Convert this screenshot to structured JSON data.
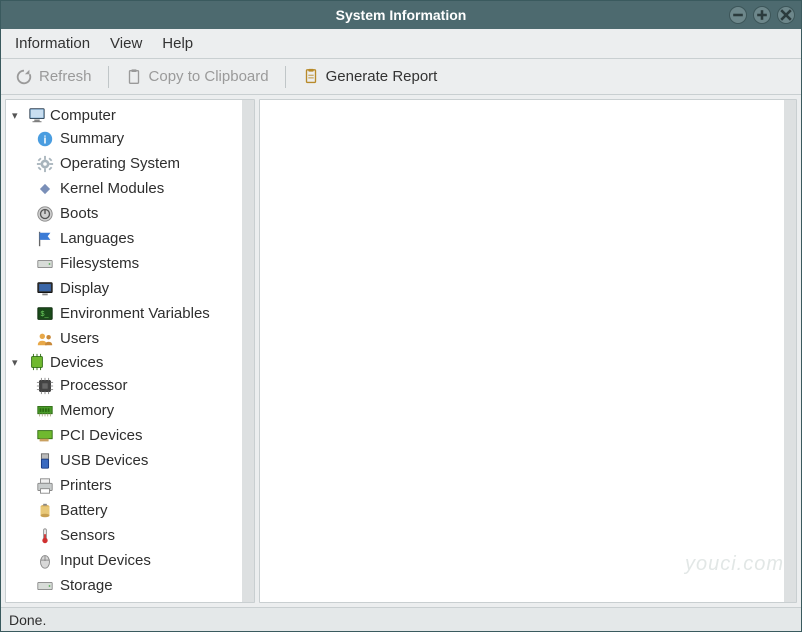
{
  "window": {
    "title": "System Information"
  },
  "menubar": {
    "items": [
      "Information",
      "View",
      "Help"
    ]
  },
  "toolbar": {
    "refresh": "Refresh",
    "copy": "Copy to Clipboard",
    "report": "Generate Report"
  },
  "tree": {
    "groups": [
      {
        "label": "Computer",
        "icon": "computer-icon",
        "items": [
          {
            "label": "Summary",
            "icon": "info-icon"
          },
          {
            "label": "Operating System",
            "icon": "gear-icon"
          },
          {
            "label": "Kernel Modules",
            "icon": "diamond-icon"
          },
          {
            "label": "Boots",
            "icon": "power-icon"
          },
          {
            "label": "Languages",
            "icon": "flag-icon"
          },
          {
            "label": "Filesystems",
            "icon": "drive-icon"
          },
          {
            "label": "Display",
            "icon": "monitor-icon"
          },
          {
            "label": "Environment Variables",
            "icon": "terminal-icon"
          },
          {
            "label": "Users",
            "icon": "users-icon"
          }
        ]
      },
      {
        "label": "Devices",
        "icon": "chip-green-icon",
        "items": [
          {
            "label": "Processor",
            "icon": "cpu-icon"
          },
          {
            "label": "Memory",
            "icon": "memory-icon"
          },
          {
            "label": "PCI Devices",
            "icon": "pci-icon"
          },
          {
            "label": "USB Devices",
            "icon": "usb-icon"
          },
          {
            "label": "Printers",
            "icon": "printer-icon"
          },
          {
            "label": "Battery",
            "icon": "battery-icon"
          },
          {
            "label": "Sensors",
            "icon": "thermometer-icon"
          },
          {
            "label": "Input Devices",
            "icon": "mouse-icon"
          },
          {
            "label": "Storage",
            "icon": "drive-icon"
          }
        ]
      }
    ]
  },
  "status": {
    "text": "Done."
  },
  "watermark": "youci.com"
}
